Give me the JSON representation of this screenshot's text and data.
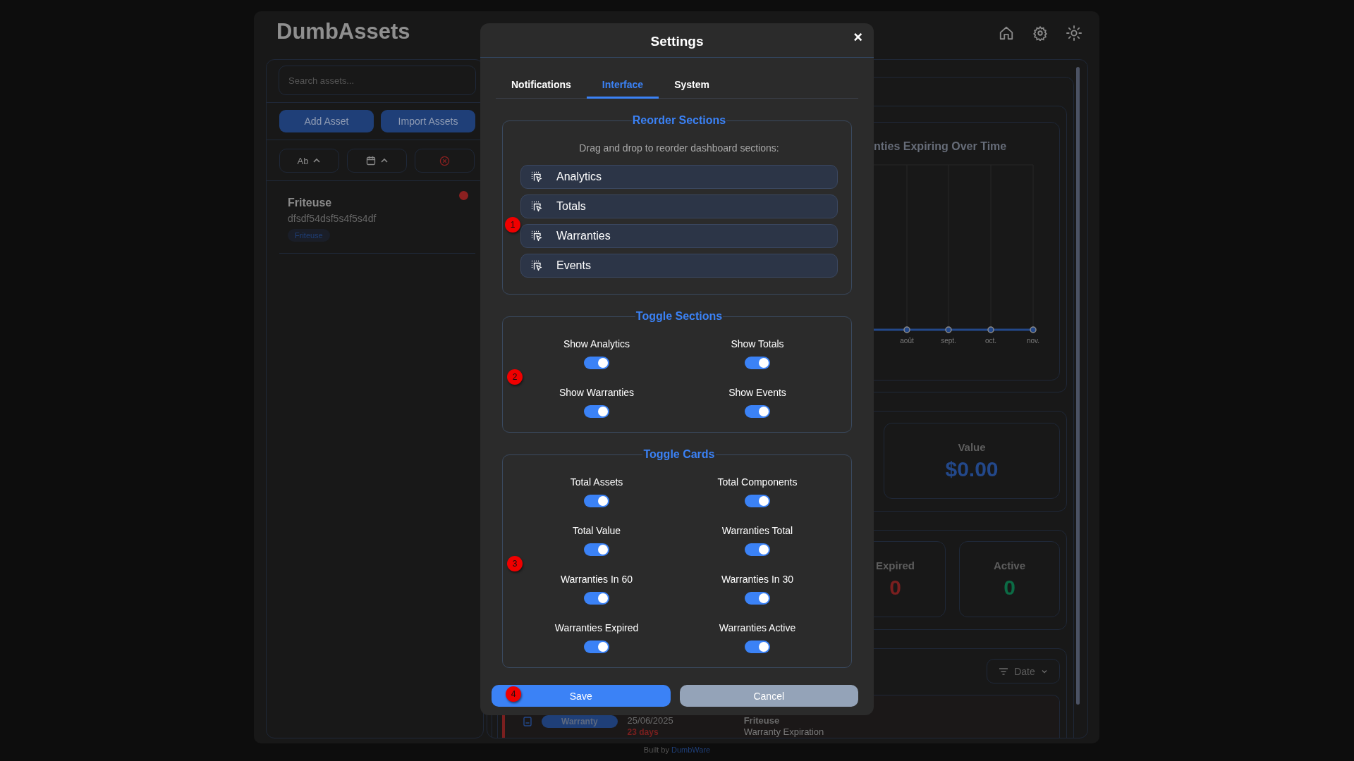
{
  "app": {
    "title": "DumbAssets"
  },
  "sidebar": {
    "search": {
      "placeholder": "Search assets..."
    },
    "buttons": [
      "Add Asset",
      "Import Assets"
    ],
    "name_sort_label": "Ab",
    "assets": [
      {
        "title": "Friteuse",
        "subtitle": "dfsdf54dsf5s4f5s4df",
        "tag": "Friteuse"
      }
    ]
  },
  "dashboard": {
    "chart_title": "nties Expiring Over Time",
    "month_labels": [
      "août",
      "sept.",
      "oct.",
      "nov."
    ],
    "value_card": {
      "label": "Value",
      "value": "$0.00"
    },
    "warranty_cards": [
      {
        "label": "Expired",
        "value": "0",
        "kind": "expired"
      },
      {
        "label": "Active",
        "value": "0",
        "kind": "active"
      }
    ],
    "events_filter": "Date",
    "event": {
      "badge": "Warranty",
      "date": "25/06/2025",
      "days": "23 days",
      "title": "Friteuse",
      "subtitle": "Warranty Expiration"
    }
  },
  "modal": {
    "title": "Settings",
    "close": "×",
    "tabs": [
      {
        "label": "Notifications",
        "selected": false
      },
      {
        "label": "Interface",
        "selected": true
      },
      {
        "label": "System",
        "selected": false
      }
    ],
    "reorder": {
      "legend": "Reorder Sections",
      "hint": "Drag and drop to reorder dashboard sections:",
      "marker": "1",
      "items": [
        "Analytics",
        "Totals",
        "Warranties",
        "Events"
      ]
    },
    "toggle_groups": [
      {
        "legend": "Toggle Sections",
        "marker": "2",
        "items": [
          {
            "label": "Show Analytics",
            "on": true
          },
          {
            "label": "Show Totals",
            "on": true
          },
          {
            "label": "Show Warranties",
            "on": true
          },
          {
            "label": "Show Events",
            "on": true
          }
        ]
      },
      {
        "legend": "Toggle Cards",
        "marker": "3",
        "items": [
          {
            "label": "Total Assets",
            "on": true
          },
          {
            "label": "Total Components",
            "on": true
          },
          {
            "label": "Total Value",
            "on": true
          },
          {
            "label": "Warranties Total",
            "on": true
          },
          {
            "label": "Warranties In 60",
            "on": true
          },
          {
            "label": "Warranties In 30",
            "on": true
          },
          {
            "label": "Warranties Expired",
            "on": true
          },
          {
            "label": "Warranties Active",
            "on": true
          }
        ]
      }
    ],
    "buttons": [
      {
        "label": "Save",
        "kind": "primary",
        "marker": "4"
      },
      {
        "label": "Cancel",
        "kind": "secondary"
      }
    ]
  },
  "footer": {
    "text": "Built by",
    "link": "DumbWare"
  }
}
